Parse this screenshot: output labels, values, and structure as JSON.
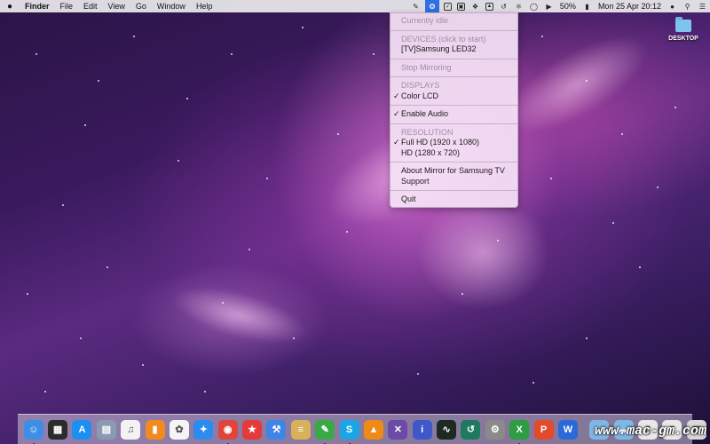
{
  "menubar": {
    "app_name": "Finder",
    "menus": [
      "File",
      "Edit",
      "View",
      "Go",
      "Window",
      "Help"
    ],
    "battery": "50%",
    "datetime": "Mon 25 Apr  20:12"
  },
  "status_icons": [
    "evernote-icon",
    "mirror-icon",
    "dashlane-icon",
    "bookmark-icon",
    "dropbox-icon",
    "airplay-icon",
    "timemachine-icon",
    "bluetooth-icon",
    "wifi-icon",
    "volume-icon",
    "battery-icon",
    "user-icon",
    "spotlight-icon",
    "notifications-icon"
  ],
  "dropdown": {
    "status": "Currently idle",
    "devices_header": "DEVICES (click to start)",
    "device": "[TV]Samsung LED32",
    "stop_mirroring": "Stop Mirroring",
    "displays_header": "DISPLAYS",
    "display": "Color LCD",
    "enable_audio": "Enable Audio",
    "resolution_header": "RESOLUTION",
    "res_full_hd": "Full HD  (1920 x 1080)",
    "res_hd": "HD  (1280 x 720)",
    "about": "About Mirror for Samsung TV",
    "support": "Support",
    "quit": "Quit",
    "checked": [
      "Color LCD",
      "Enable Audio",
      "Full HD  (1920 x 1080)"
    ]
  },
  "desktop": {
    "folder_label": "DESKTOP"
  },
  "dock": {
    "apps": [
      {
        "name": "finder-icon",
        "color": "#3c8ee6",
        "glyph": "☺",
        "running": true
      },
      {
        "name": "mission-control-icon",
        "color": "#2b2b2b",
        "glyph": "▦",
        "running": false
      },
      {
        "name": "app-store-icon",
        "color": "#1d8ff0",
        "glyph": "A",
        "running": false
      },
      {
        "name": "preview-icon",
        "color": "#8a9bb0",
        "glyph": "▤",
        "running": false
      },
      {
        "name": "itunes-icon",
        "color": "#f3f3f3",
        "glyph": "♫",
        "running": false
      },
      {
        "name": "ibooks-icon",
        "color": "#f28a1f",
        "glyph": "▮",
        "running": false
      },
      {
        "name": "photos-icon",
        "color": "#f5f5f5",
        "glyph": "✿",
        "running": false
      },
      {
        "name": "safari-icon",
        "color": "#2a8cf0",
        "glyph": "✦",
        "running": false
      },
      {
        "name": "chrome-icon",
        "color": "#e0443a",
        "glyph": "◉",
        "running": true
      },
      {
        "name": "bookmarks-icon",
        "color": "#e33b3b",
        "glyph": "★",
        "running": false
      },
      {
        "name": "xcode-icon",
        "color": "#3f85e5",
        "glyph": "⚒",
        "running": false
      },
      {
        "name": "stack-icon",
        "color": "#d9b15a",
        "glyph": "≡",
        "running": false
      },
      {
        "name": "evernote-icon",
        "color": "#3aa845",
        "glyph": "✎",
        "running": true
      },
      {
        "name": "skype-icon",
        "color": "#1aa6e6",
        "glyph": "S",
        "running": true
      },
      {
        "name": "vlc-icon",
        "color": "#f08a16",
        "glyph": "▲",
        "running": false
      },
      {
        "name": "crossover-icon",
        "color": "#6b4aa8",
        "glyph": "✕",
        "running": false
      },
      {
        "name": "info-icon",
        "color": "#3e57c9",
        "glyph": "i",
        "running": false
      },
      {
        "name": "activity-monitor-icon",
        "color": "#1c2a22",
        "glyph": "∿",
        "running": false
      },
      {
        "name": "time-machine-icon",
        "color": "#1d7a5e",
        "glyph": "↺",
        "running": false
      },
      {
        "name": "system-preferences-icon",
        "color": "#8a8a8a",
        "glyph": "⚙",
        "running": false
      },
      {
        "name": "excel-icon",
        "color": "#2e9c40",
        "glyph": "X",
        "running": true
      },
      {
        "name": "powerpoint-icon",
        "color": "#e24a2b",
        "glyph": "P",
        "running": false
      },
      {
        "name": "word-icon",
        "color": "#2a6ad8",
        "glyph": "W",
        "running": false
      },
      {
        "name": "documents-folder-icon",
        "color": "#7fb6e6",
        "glyph": "▬",
        "running": false
      },
      {
        "name": "downloads-folder-icon",
        "color": "#7fb6e6",
        "glyph": "▬",
        "running": false
      },
      {
        "name": "file-icon",
        "color": "#e8e8e8",
        "glyph": "▯",
        "running": false
      },
      {
        "name": "file-icon-2",
        "color": "#e8e8e8",
        "glyph": "▯",
        "running": false
      },
      {
        "name": "trash-icon",
        "color": "#d8d8d8",
        "glyph": "▥",
        "running": false
      }
    ]
  },
  "watermark": "www.mac-gm.com"
}
